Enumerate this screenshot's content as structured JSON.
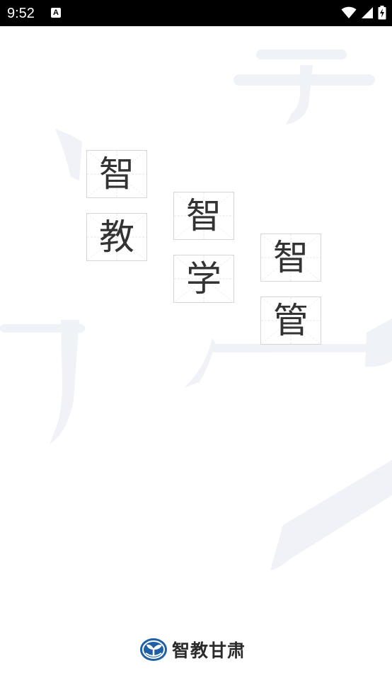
{
  "status_bar": {
    "time": "9:52",
    "notification_icon_label": "A",
    "icons": [
      "notification-icon",
      "wifi-icon",
      "cellular-signal-icon",
      "battery-charging-icon"
    ]
  },
  "splash": {
    "characters": [
      "智",
      "教",
      "智",
      "学",
      "智",
      "管"
    ]
  },
  "brand": {
    "name": "智教甘肃",
    "logo_icon": "sprout-logo-icon",
    "logo_color": "#1e5fa8"
  }
}
